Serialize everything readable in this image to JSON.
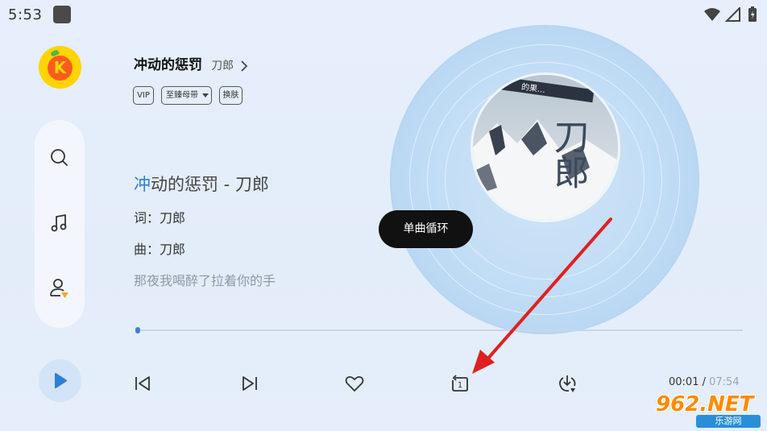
{
  "status_bar": {
    "time": "5:53"
  },
  "app": {
    "logo_letter": "K",
    "accent": "#2f7fd3",
    "logo_color": "#ffd400"
  },
  "header": {
    "title": "冲动的惩罚",
    "artist": "刀郎",
    "tags": [
      "VIP",
      "至臻母带",
      "换肤"
    ],
    "quality_dropdown_icon": "caret-down-icon"
  },
  "lyrics": {
    "title_highlight": "冲",
    "title_rest": "动的惩罚 - 刀郎",
    "lines": [
      "词：刀郎",
      "曲：刀郎"
    ],
    "upcoming": "那夜我喝醉了拉着你的手"
  },
  "album_art": {
    "big_text": "刀郎",
    "banner": "的果…"
  },
  "toast": {
    "text": "单曲循环"
  },
  "progress": {
    "fraction": 0.0
  },
  "time": {
    "current": "00:01",
    "separator": " / ",
    "total": "07:54"
  },
  "controls": [
    "previous-icon",
    "next-icon",
    "heart-icon",
    "repeat-one-icon",
    "download-icon"
  ],
  "watermark": {
    "main": "962.NET",
    "sub": "乐游网"
  }
}
